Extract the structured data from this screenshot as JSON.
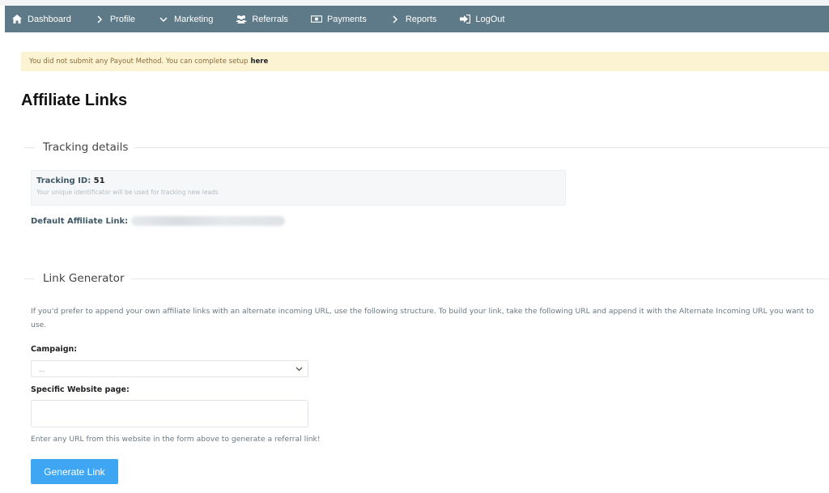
{
  "nav": {
    "items": [
      {
        "label": "Dashboard",
        "icon": "home-icon"
      },
      {
        "label": "Profile",
        "icon": "chevron-right-icon"
      },
      {
        "label": "Marketing",
        "icon": "chevron-down-icon"
      },
      {
        "label": "Referrals",
        "icon": "users-icon"
      },
      {
        "label": "Payments",
        "icon": "money-icon"
      },
      {
        "label": "Reports",
        "icon": "chevron-right-icon"
      },
      {
        "label": "LogOut",
        "icon": "sign-out-icon"
      }
    ]
  },
  "alert": {
    "text": "You did not submit any Payout Method. You can complete setup",
    "link": "here"
  },
  "page": {
    "title": "Affiliate Links"
  },
  "tracking": {
    "legend": "Tracking details",
    "id_label": "Tracking ID:",
    "id_value": "51",
    "description": "Your unique identificator will be used for tracking new leads",
    "default_link_label": "Default Affiliate Link:"
  },
  "generator": {
    "legend": "Link Generator",
    "description": "If you'd prefer to append your own affiliate links with an alternate incoming URL, use the following structure. To build your link, take the following URL and append it with the Alternate Incoming URL you want to use.",
    "campaign_label": "Campaign:",
    "campaign_selected": "...",
    "page_label": "Specific Website page:",
    "page_value": "",
    "hint": "Enter any URL from this website in the form above to generate a referral link!",
    "button": "Generate Link"
  },
  "colors": {
    "navbar": "#5e7a88",
    "alert_bg": "#fcf3d3",
    "button": "#3ea6f2"
  }
}
